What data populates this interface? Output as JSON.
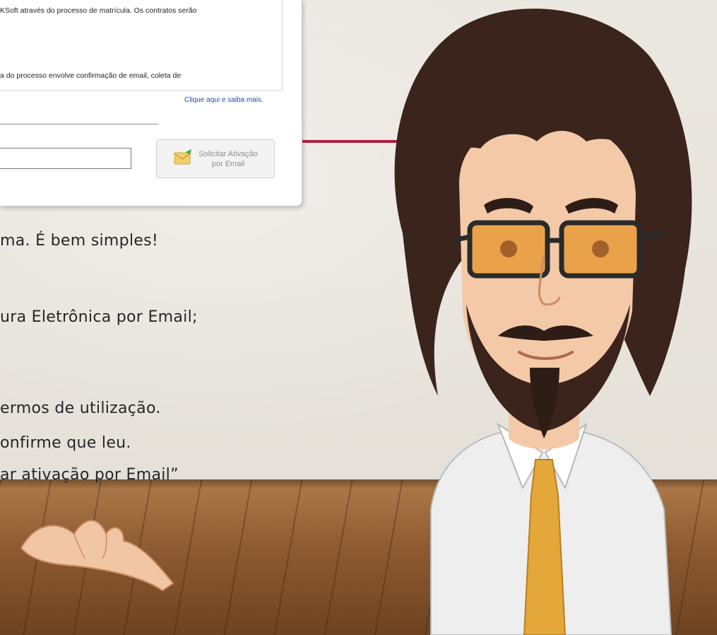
{
  "dialog": {
    "text_lines": [
      "KSoft através do processo de matrícula. Os contratos serão",
      "a do processo envolve confirmação de email, coleta de"
    ],
    "link": "Clique aqui e saiba mais.",
    "email_value": "",
    "button_label": "Solicitar Ativação\npor Email"
  },
  "slide": {
    "lines": [
      "ma. É bem simples!",
      "ura Eletrônica por Email;",
      "ermos de utilização.",
      "onfirme que leu.",
      "ar ativação por Email”"
    ]
  },
  "colors": {
    "accent": "#b0203e",
    "link": "#1f4fa8"
  }
}
